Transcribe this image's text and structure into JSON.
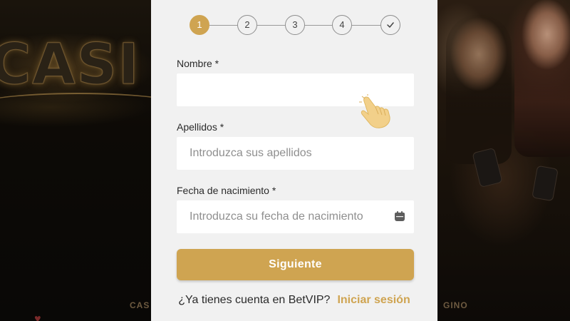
{
  "background": {
    "left_word": "CASI",
    "left_footer_fragment": "CAS",
    "right_footer_fragment": "GINO"
  },
  "stepper": {
    "steps": [
      {
        "label": "1",
        "state": "active"
      },
      {
        "label": "2",
        "state": "pending"
      },
      {
        "label": "3",
        "state": "pending"
      },
      {
        "label": "4",
        "state": "pending"
      },
      {
        "icon": "check-icon",
        "state": "pending"
      }
    ],
    "active_color": "#cfa451"
  },
  "form": {
    "nombre": {
      "label": "Nombre *",
      "placeholder": "",
      "value": ""
    },
    "apellidos": {
      "label": "Apellidos *",
      "placeholder": "Introduzca sus apellidos",
      "value": ""
    },
    "fecha": {
      "label": "Fecha de nacimiento *",
      "placeholder": "Introduzca su fecha de nacimiento",
      "value": "",
      "icon": "calendar-icon"
    }
  },
  "actions": {
    "next_label": "Siguiente",
    "login_prompt": "¿Ya tienes cuenta en BetVIP?",
    "login_link": "Iniciar sesión"
  },
  "colors": {
    "accent": "#cfa451",
    "panel_bg": "#f1f1f1",
    "field_bg": "#ffffff"
  },
  "cursor": {
    "icon": "pointer-hand-icon"
  }
}
